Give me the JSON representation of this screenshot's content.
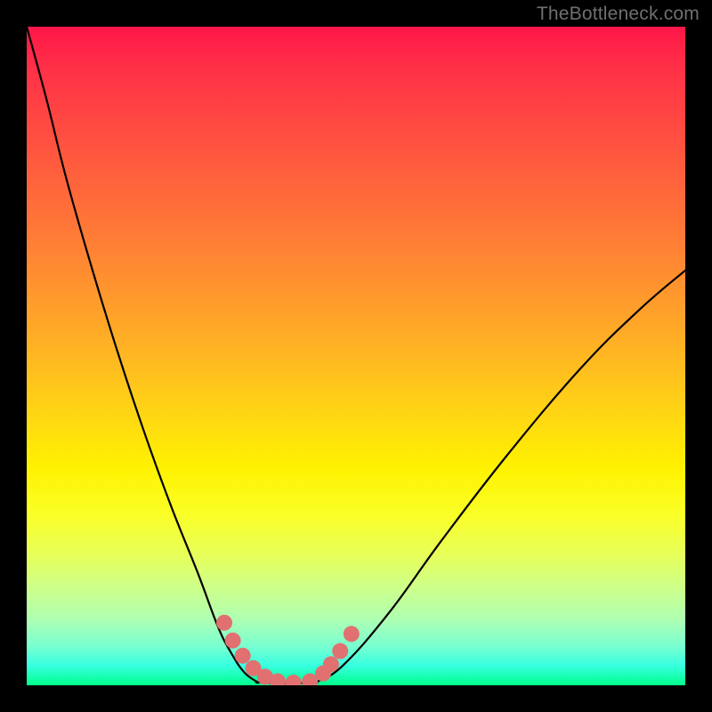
{
  "watermark": "TheBottleneck.com",
  "colors": {
    "page_bg": "#000000",
    "watermark": "#6f6f6f",
    "curve": "#000000",
    "marker_fill": "#e17070",
    "marker_stroke": "#d95f5f"
  },
  "chart_data": {
    "type": "line",
    "title": "",
    "xlabel": "",
    "ylabel": "",
    "xlim": [
      0,
      1
    ],
    "ylim": [
      0,
      1
    ],
    "note": "No numeric axes shown; values given in normalized plot coords (0=left/bottom, 1=right/top).",
    "series": [
      {
        "name": "left-branch",
        "x": [
          0.0,
          0.03,
          0.06,
          0.1,
          0.14,
          0.18,
          0.22,
          0.26,
          0.29,
          0.31,
          0.33,
          0.35
        ],
        "y": [
          1.0,
          0.89,
          0.77,
          0.63,
          0.5,
          0.38,
          0.27,
          0.17,
          0.09,
          0.05,
          0.02,
          0.005
        ]
      },
      {
        "name": "valley-floor",
        "x": [
          0.35,
          0.38,
          0.41,
          0.44
        ],
        "y": [
          0.005,
          0.003,
          0.003,
          0.005
        ]
      },
      {
        "name": "right-branch",
        "x": [
          0.44,
          0.48,
          0.55,
          0.63,
          0.73,
          0.84,
          0.93,
          1.0
        ],
        "y": [
          0.005,
          0.03,
          0.11,
          0.22,
          0.35,
          0.48,
          0.57,
          0.63
        ]
      }
    ],
    "markers": {
      "name": "highlighted-points",
      "note": "pink dot markers near the valley",
      "x": [
        0.3,
        0.313,
        0.328,
        0.344,
        0.362,
        0.381,
        0.405,
        0.43,
        0.45,
        0.462,
        0.476,
        0.493
      ],
      "y": [
        0.095,
        0.068,
        0.045,
        0.026,
        0.013,
        0.006,
        0.004,
        0.006,
        0.018,
        0.032,
        0.052,
        0.078
      ]
    },
    "gradient_stops": [
      {
        "pos": 0.0,
        "color": "#ff1649"
      },
      {
        "pos": 0.18,
        "color": "#ff5340"
      },
      {
        "pos": 0.46,
        "color": "#ffa927"
      },
      {
        "pos": 0.67,
        "color": "#fff200"
      },
      {
        "pos": 0.85,
        "color": "#ceff88"
      },
      {
        "pos": 1.0,
        "color": "#00ff8b"
      }
    ]
  }
}
